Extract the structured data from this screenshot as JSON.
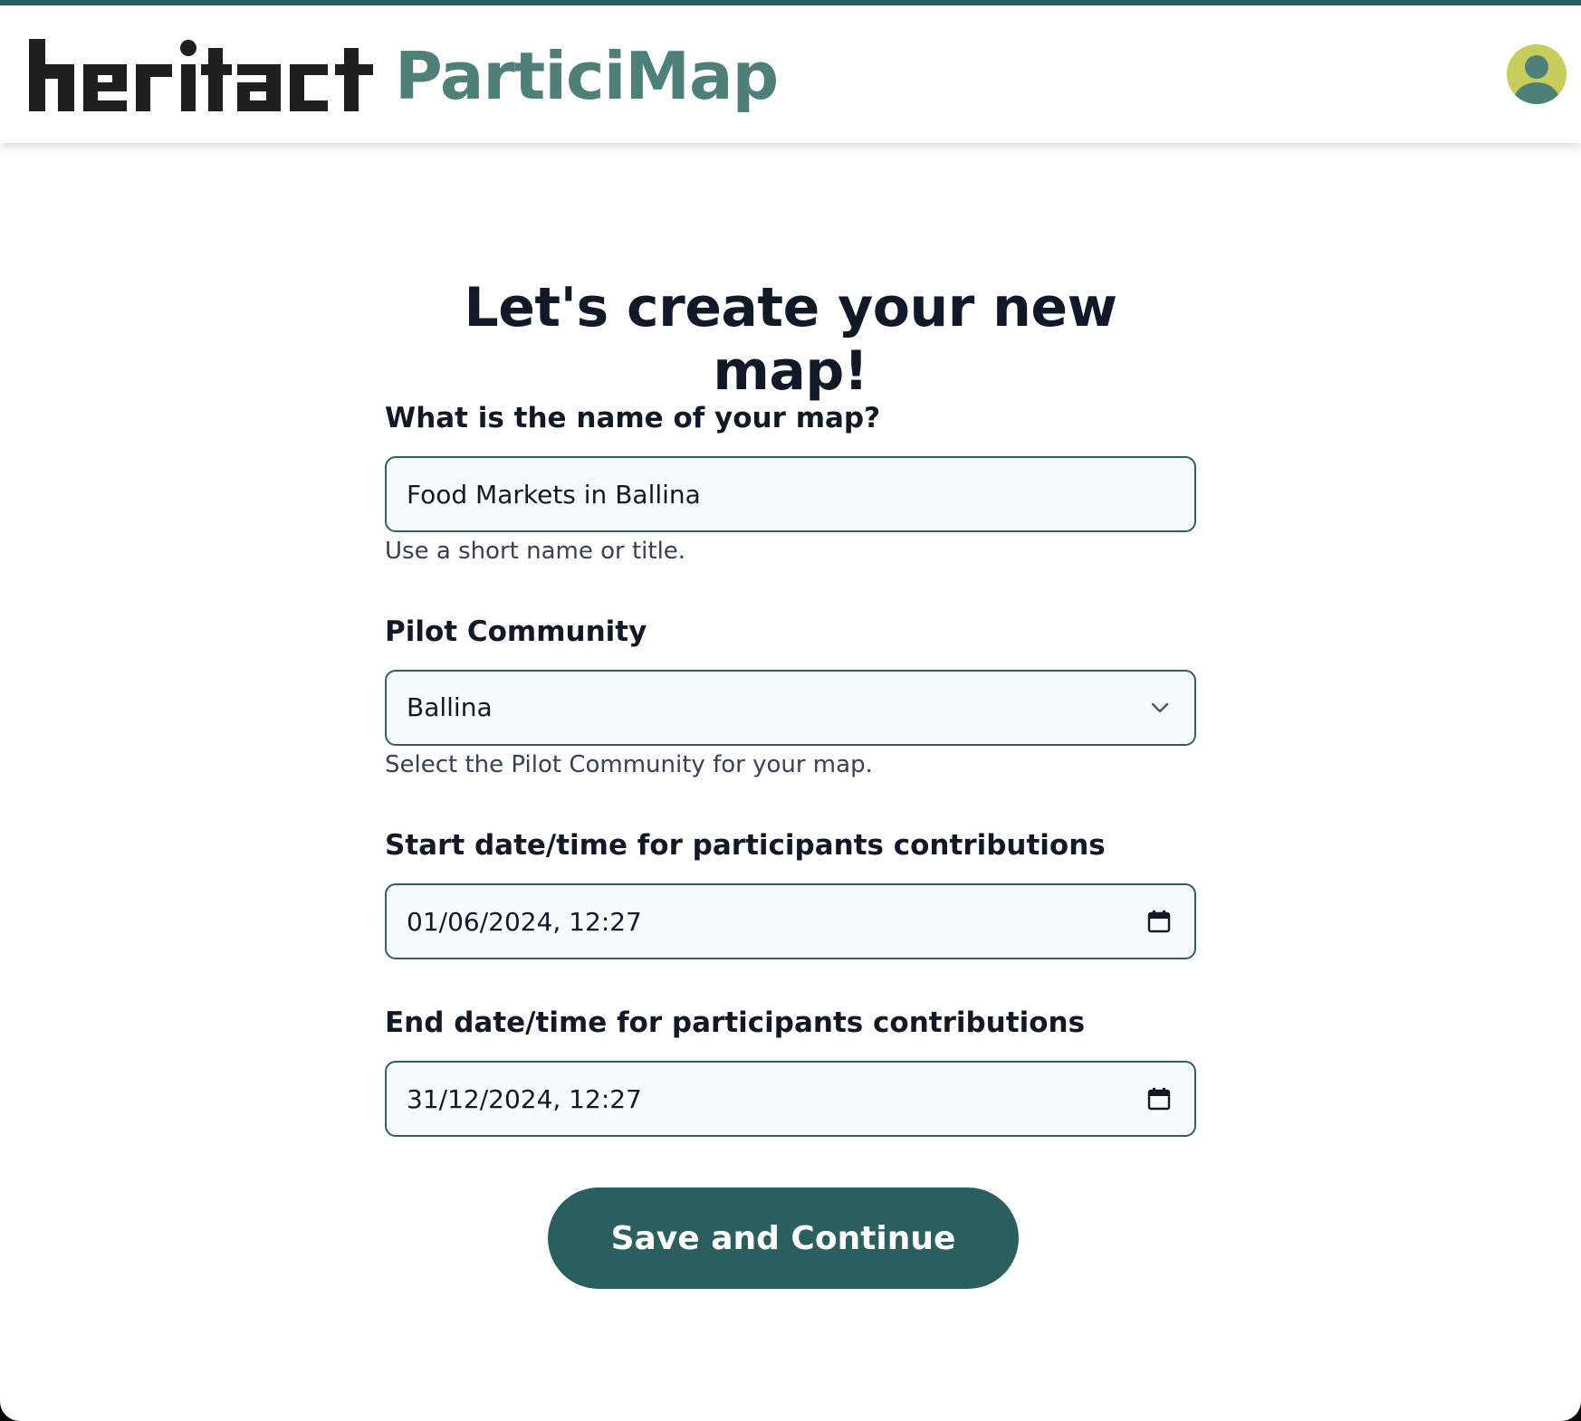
{
  "header": {
    "logo_text": "heritact",
    "app_name": "ParticiMap"
  },
  "colors": {
    "brand_teal": "#2b5f5f",
    "logo_teal": "#4e7f79",
    "avatar_bg": "#c6cd5a"
  },
  "form": {
    "title": "Let's create your new map!",
    "map_name": {
      "label": "What is the name of your map?",
      "value": "Food Markets in Ballina",
      "helper": "Use a short name or title."
    },
    "pilot_community": {
      "label": "Pilot Community",
      "selected": "Ballina",
      "helper": "Select the Pilot Community for your map."
    },
    "start_date": {
      "label": "Start date/time for participants contributions",
      "value": "01/06/2024, 12:27"
    },
    "end_date": {
      "label": "End date/time for participants contributions",
      "value": "31/12/2024, 12:27"
    },
    "submit_label": "Save and Continue"
  },
  "icons": {
    "avatar": "user-avatar-icon",
    "dropdown": "chevron-down-icon",
    "calendar": "calendar-icon"
  }
}
